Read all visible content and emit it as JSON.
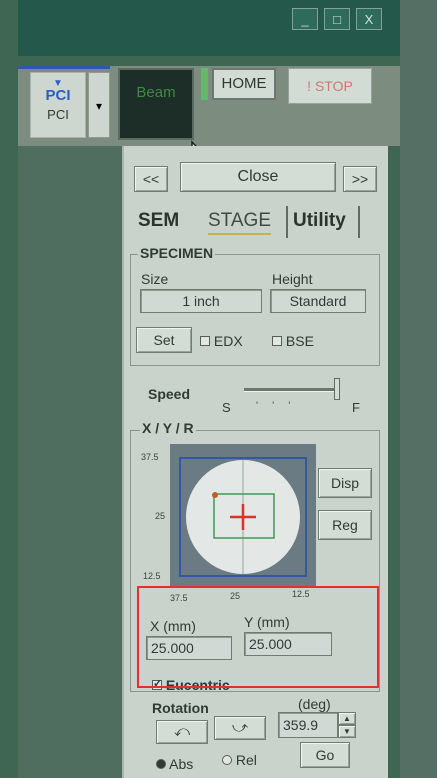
{
  "titlebar": {
    "minimize": "_",
    "maximize": "□",
    "close": "X"
  },
  "toolbar": {
    "pci_icon_label": "PCI",
    "pci_label": "PCI",
    "dropdown_glyph": "▾",
    "beam_label": "Beam",
    "home_label": "HOME",
    "stop_label": "! STOP"
  },
  "panel": {
    "nav_prev": "<<",
    "close_label": "Close",
    "nav_next": ">>",
    "tabs": [
      {
        "label": "SEM"
      },
      {
        "label": "STAGE"
      },
      {
        "label": "Utility"
      }
    ],
    "specimen": {
      "title": "SPECIMEN",
      "size_label": "Size",
      "size_value": "1 inch",
      "height_label": "Height",
      "height_value": "Standard",
      "set_label": "Set",
      "edx_label": "EDX",
      "bse_label": "BSE"
    },
    "speed": {
      "label": "Speed",
      "slow": "S",
      "fast": "F",
      "level": 1.0
    },
    "xyr": {
      "title": "X / Y / R",
      "ticks_left": [
        "37.5",
        "25",
        "12.5"
      ],
      "ticks_bottom": [
        "37.5",
        "25",
        "12.5"
      ],
      "disp_label": "Disp",
      "reg_label": "Reg",
      "x_label": "X (mm)",
      "x_value": "25.000",
      "y_label": "Y (mm)",
      "y_value": "25.000"
    },
    "eucentric_label": "Eucentric",
    "rotation": {
      "label": "Rotation",
      "unit": "(deg)",
      "value": "359.9",
      "abs_label": "Abs",
      "rel_label": "Rel",
      "go_label": "Go"
    }
  },
  "highlight_color": "#e03030"
}
